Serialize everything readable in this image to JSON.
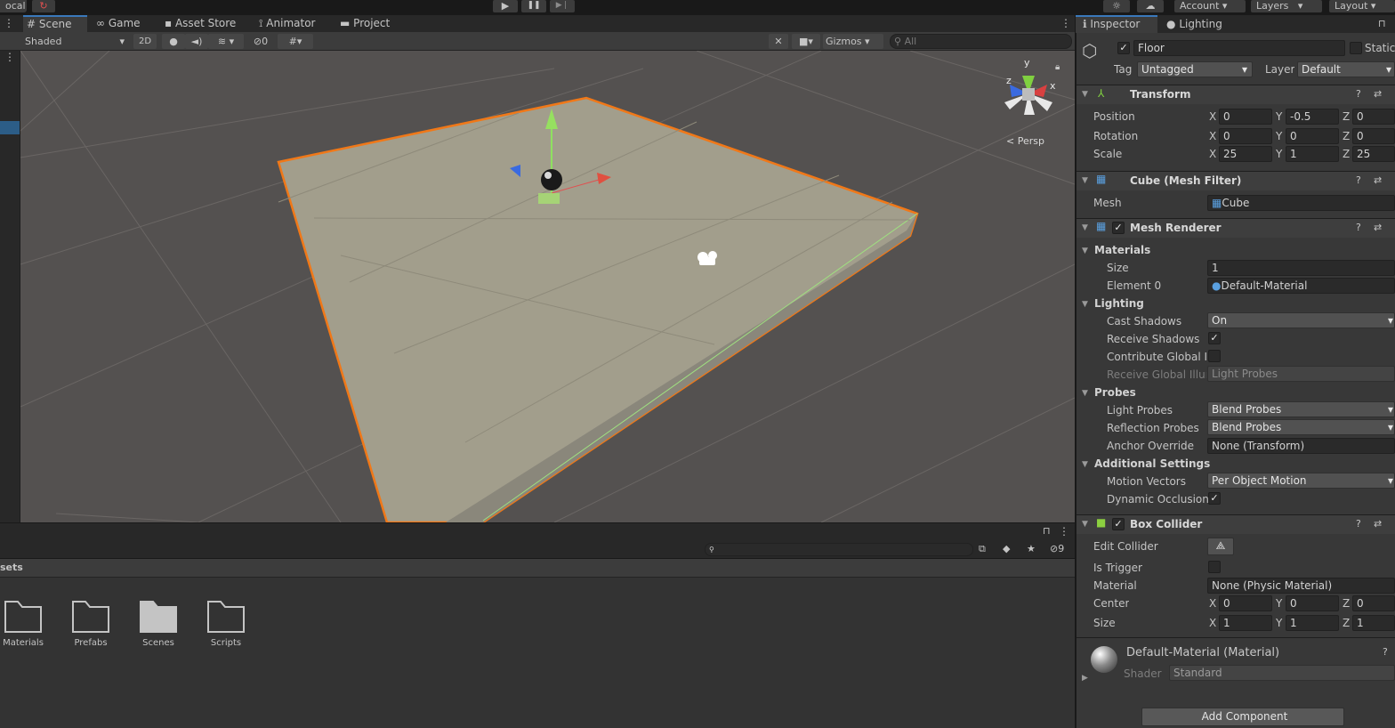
{
  "topbar": {
    "local": "ocal",
    "account": "Account",
    "layers": "Layers",
    "layout": "Layout"
  },
  "scene_tabs": [
    "Scene",
    "Game",
    "Asset Store",
    "Animator",
    "Project"
  ],
  "scene_toolbar": {
    "shading": "Shaded",
    "two_d": "2D",
    "hidden_count": "0",
    "gizmos": "Gizmos",
    "search_placeholder": "All"
  },
  "viewport": {
    "projection": "Persp",
    "gizmo_axes": {
      "y": "y",
      "x": "x",
      "z": "z"
    }
  },
  "project": {
    "breadcrumb": "sets",
    "hidden_count": "9",
    "folders": [
      "Materials",
      "Prefabs",
      "Scenes",
      "Scripts"
    ]
  },
  "inspector": {
    "tabs": [
      "Inspector",
      "Lighting"
    ],
    "object_name": "Floor",
    "static_label": "Static",
    "tag_label": "Tag",
    "tag": "Untagged",
    "layer_label": "Layer",
    "layer": "Default",
    "transform": {
      "title": "Transform",
      "position_label": "Position",
      "position": {
        "x": "0",
        "y": "-0.5",
        "z": "0"
      },
      "rotation_label": "Rotation",
      "rotation": {
        "x": "0",
        "y": "0",
        "z": "0"
      },
      "scale_label": "Scale",
      "scale": {
        "x": "25",
        "y": "1",
        "z": "25"
      }
    },
    "mesh_filter": {
      "title": "Cube (Mesh Filter)",
      "mesh_label": "Mesh",
      "mesh": "Cube"
    },
    "mesh_renderer": {
      "title": "Mesh Renderer",
      "materials_label": "Materials",
      "size_label": "Size",
      "size": "1",
      "element0_label": "Element 0",
      "element0": "Default-Material",
      "lighting_label": "Lighting",
      "cast_shadows_label": "Cast Shadows",
      "cast_shadows": "On",
      "receive_shadows_label": "Receive Shadows",
      "contribute_gi_label": "Contribute Global Illu",
      "receive_gi_label": "Receive Global Illum",
      "receive_gi": "Light Probes",
      "probes_label": "Probes",
      "light_probes_label": "Light Probes",
      "light_probes": "Blend Probes",
      "reflection_probes_label": "Reflection Probes",
      "reflection_probes": "Blend Probes",
      "anchor_override_label": "Anchor Override",
      "anchor_override": "None (Transform)",
      "additional_label": "Additional Settings",
      "motion_vectors_label": "Motion Vectors",
      "motion_vectors": "Per Object Motion",
      "dynamic_occlusion_label": "Dynamic Occlusion"
    },
    "box_collider": {
      "title": "Box Collider",
      "edit_collider_label": "Edit Collider",
      "is_trigger_label": "Is Trigger",
      "material_label": "Material",
      "material": "None (Physic Material)",
      "center_label": "Center",
      "center": {
        "x": "0",
        "y": "0",
        "z": "0"
      },
      "size_label": "Size",
      "size": {
        "x": "1",
        "y": "1",
        "z": "1"
      }
    },
    "material": {
      "title": "Default-Material (Material)",
      "shader_label": "Shader",
      "shader": "Standard"
    },
    "add_component": "Add Component"
  }
}
